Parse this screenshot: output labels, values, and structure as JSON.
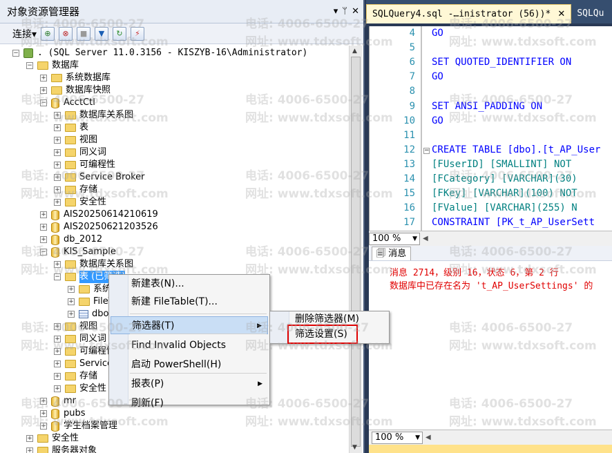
{
  "object_explorer": {
    "title": "对象资源管理器",
    "title_buttons": [
      "▾",
      "ᛘ",
      "✕"
    ],
    "toolbar": {
      "connect_label": "连接▾",
      "icons": [
        "connect-icon",
        "disconnect-icon",
        "stop-icon",
        "filter-icon",
        "refresh-icon",
        "activity-icon"
      ]
    },
    "tree": [
      {
        "label": ". (SQL Server 11.0.3156 - KISZYB-16\\Administrator)",
        "type": "server",
        "exp": "-"
      },
      {
        "label": "数据库",
        "type": "folder",
        "exp": "-"
      },
      {
        "label": "系统数据库",
        "type": "folder",
        "exp": "+"
      },
      {
        "label": "数据库快照",
        "type": "folder",
        "exp": "+"
      },
      {
        "label": "AcctCtl",
        "type": "db",
        "exp": "-"
      },
      {
        "label": "数据库关系图",
        "type": "folder",
        "exp": "+"
      },
      {
        "label": "表",
        "type": "folder",
        "exp": "+"
      },
      {
        "label": "视图",
        "type": "folder",
        "exp": "+"
      },
      {
        "label": "同义词",
        "type": "folder",
        "exp": "+"
      },
      {
        "label": "可编程性",
        "type": "folder",
        "exp": "+"
      },
      {
        "label": "Service Broker",
        "type": "folder",
        "exp": "+"
      },
      {
        "label": "存储",
        "type": "folder",
        "exp": "+"
      },
      {
        "label": "安全性",
        "type": "folder",
        "exp": "+"
      },
      {
        "label": "AIS20250614210619",
        "type": "db",
        "exp": "+"
      },
      {
        "label": "AIS20250621203526",
        "type": "db",
        "exp": "+"
      },
      {
        "label": "db_2012",
        "type": "db",
        "exp": "+"
      },
      {
        "label": "KIS_Sample",
        "type": "db",
        "exp": "-"
      },
      {
        "label": "数据库关系图",
        "type": "folder",
        "exp": "+"
      },
      {
        "label": "表 (已筛选)",
        "type": "folder",
        "exp": "-"
      },
      {
        "label": "系统表",
        "type": "folder",
        "exp": "+"
      },
      {
        "label": "FileTables",
        "type": "folder",
        "exp": "+"
      },
      {
        "label": "dbo.t_AP_UserSettings",
        "type": "table",
        "exp": "+"
      },
      {
        "label": "视图",
        "type": "folder",
        "exp": "+"
      },
      {
        "label": "同义词",
        "type": "folder",
        "exp": "+"
      },
      {
        "label": "可编程性",
        "type": "folder",
        "exp": "+"
      },
      {
        "label": "Service Broker",
        "type": "folder",
        "exp": "+"
      },
      {
        "label": "存储",
        "type": "folder",
        "exp": "+"
      },
      {
        "label": "安全性",
        "type": "folder",
        "exp": "+"
      },
      {
        "label": "mr",
        "type": "db",
        "exp": "+"
      },
      {
        "label": "pubs",
        "type": "db",
        "exp": "+"
      },
      {
        "label": "学生档案管理",
        "type": "db",
        "exp": "+"
      },
      {
        "label": "安全性",
        "type": "folder",
        "exp": "+"
      },
      {
        "label": "服务器对象",
        "type": "folder",
        "exp": "+"
      }
    ]
  },
  "context_menu": {
    "items": [
      {
        "label": "新建表(N)...",
        "submenu": false
      },
      {
        "label": "新建 FileTable(T)...",
        "submenu": false
      },
      {
        "label": "筛选器(T)",
        "submenu": true,
        "highlighted": true
      },
      {
        "label": "Find Invalid Objects",
        "submenu": false
      },
      {
        "label": "启动 PowerShell(H)",
        "submenu": false
      },
      {
        "label": "报表(P)",
        "submenu": true
      },
      {
        "label": "刷新(F)",
        "submenu": false
      }
    ]
  },
  "filter_submenu": {
    "items": [
      {
        "label": "删除筛选器(M)"
      },
      {
        "label": "筛选设置(S)"
      }
    ]
  },
  "editor": {
    "tabs": [
      {
        "label": "SQLQuery4.sql -…inistrator (56))*",
        "close": "✕",
        "active": true
      },
      {
        "label": "SQLQu",
        "active": false
      }
    ],
    "lines": [
      {
        "n": "4",
        "code": "GO",
        "cls": "kw"
      },
      {
        "n": "5",
        "code": "",
        "cls": ""
      },
      {
        "n": "6",
        "code": "SET QUOTED_IDENTIFIER ON",
        "cls": "kw"
      },
      {
        "n": "7",
        "code": "GO",
        "cls": "kw"
      },
      {
        "n": "8",
        "code": "",
        "cls": ""
      },
      {
        "n": "9",
        "code": "SET ANSI_PADDING ON",
        "cls": "kw"
      },
      {
        "n": "10",
        "code": "GO",
        "cls": "kw"
      },
      {
        "n": "11",
        "code": "",
        "cls": ""
      },
      {
        "n": "12",
        "code": "CREATE TABLE [dbo].[t_AP_User",
        "cls": "kw"
      },
      {
        "n": "13",
        "code": "    [FUserID] [SMALLINT] NOT",
        "cls": "ident"
      },
      {
        "n": "14",
        "code": "    [FCategory] [VARCHAR](30)",
        "cls": "ident"
      },
      {
        "n": "15",
        "code": "    [FKey] [VARCHAR](100) NOT",
        "cls": "ident"
      },
      {
        "n": "16",
        "code": "    [FValue] [VARCHAR](255) N",
        "cls": "ident"
      },
      {
        "n": "17",
        "code": " CONSTRAINT [PK_t_AP_UserSett",
        "cls": "kw"
      }
    ],
    "zoom": "100 %"
  },
  "results": {
    "tab_label": "消息",
    "messages": [
      "消息 2714，级别 16，状态 6，第 2 行",
      "数据库中已存在名为 't_AP_UserSettings' 的"
    ],
    "zoom": "100 %"
  },
  "watermarks": {
    "phone": "电话: 4006-6500-27",
    "url": "网址: www.tdxsoft.com"
  }
}
